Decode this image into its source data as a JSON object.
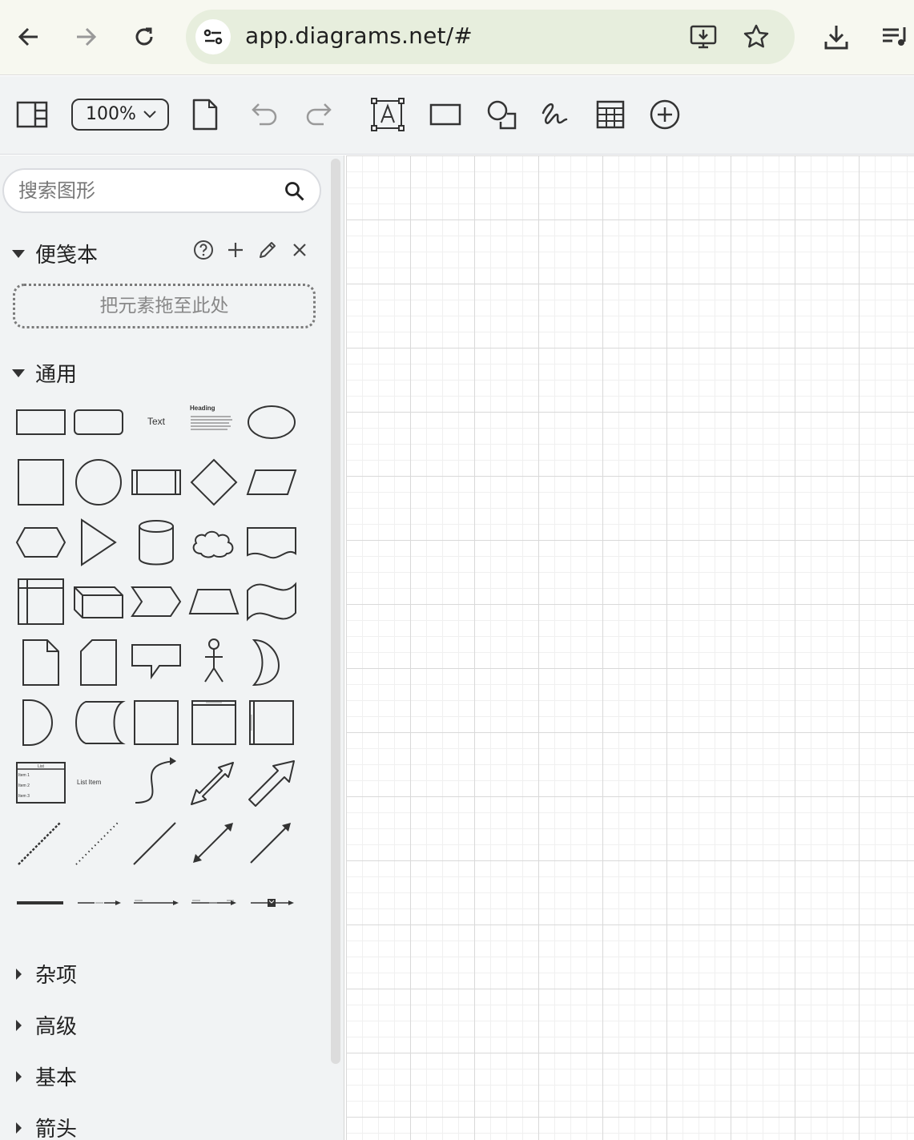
{
  "browser": {
    "url": "app.diagrams.net/#",
    "icons": [
      "back-arrow-icon",
      "forward-arrow-icon",
      "reload-icon",
      "site-settings-icon",
      "install-app-icon",
      "bookmark-star-icon",
      "download-icon",
      "reading-list-icon"
    ]
  },
  "toolbar": {
    "zoom_value": "100%"
  },
  "sidebar": {
    "search_placeholder": "搜索图形",
    "scratchpad": {
      "title": "便笺本",
      "dropzone_text": "把元素拖至此处"
    },
    "general": {
      "title": "通用",
      "shape_texts": {
        "text": "Text",
        "heading": "Heading",
        "list_title": "List",
        "list_items": [
          "Item 1",
          "Item 2",
          "Item 3"
        ],
        "list_item": "List Item"
      }
    },
    "collapsed_sections": [
      "杂项",
      "高级",
      "基本",
      "箭头"
    ]
  },
  "colors": {
    "shape_stroke": "#333333",
    "sidebar_bg": "#f1f3f4",
    "url_box_bg": "#e7eedd",
    "grid_major": "#d9d9d9",
    "grid_minor": "#f0f0f0"
  }
}
